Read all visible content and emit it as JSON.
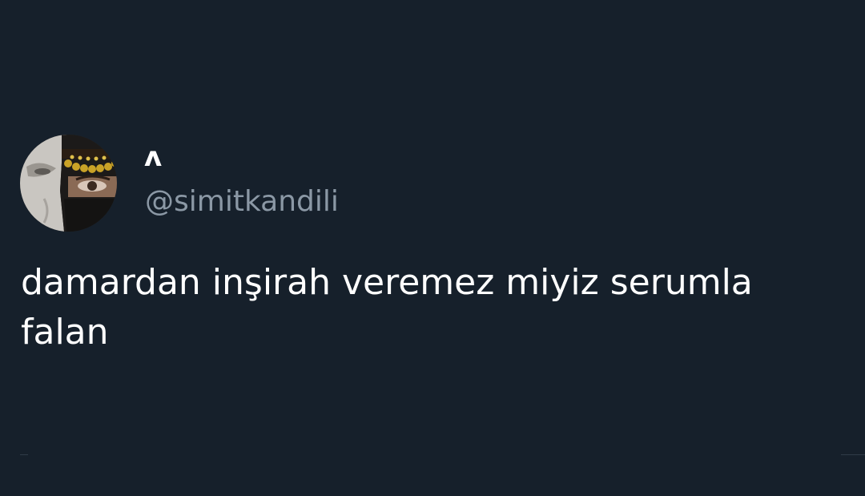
{
  "tweet": {
    "display_name": "ʌ",
    "handle": "@simitkandili",
    "text": "damardan inşirah veremez miyiz serumla falan",
    "avatar_icon": "avatar-photo"
  },
  "colors": {
    "background": "#16202b",
    "primary_text": "#ffffff",
    "secondary_text": "#8b98a5"
  }
}
